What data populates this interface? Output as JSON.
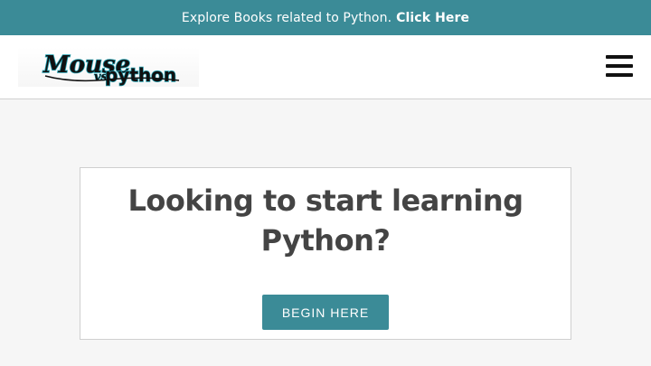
{
  "promo_bar": {
    "text": "Explore Books related to Python.",
    "link_label": "Click Here",
    "background": "#3b8b97"
  },
  "header": {
    "logo_text": "Mouse vs Python",
    "menu_icon": "hamburger-menu-icon"
  },
  "hero": {
    "title": "Looking to start learning Python?",
    "button_label": "BEGIN HERE",
    "button_color": "#3b8b97"
  }
}
